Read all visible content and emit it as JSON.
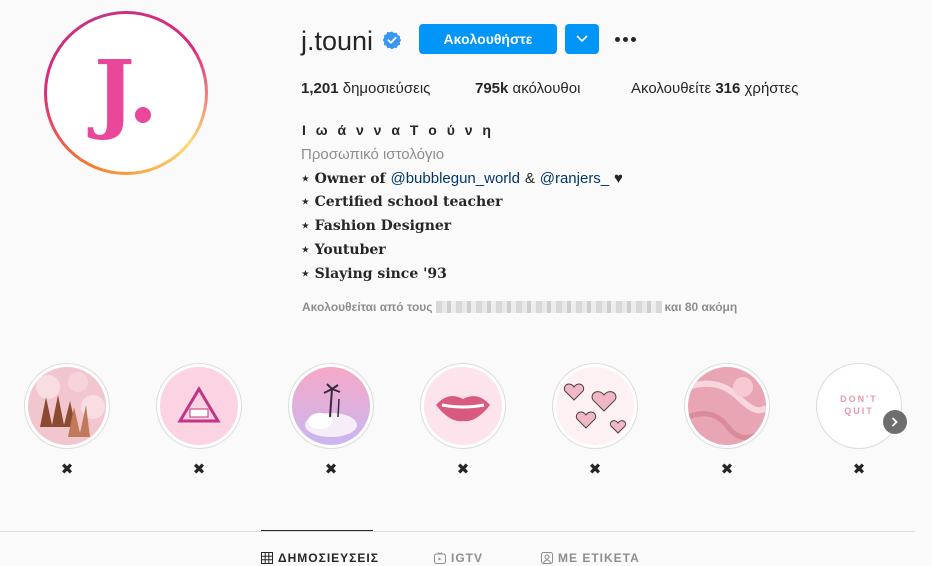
{
  "profile": {
    "username": "j.touni",
    "avatar_letter": "J.",
    "follow_label": "Ακολουθήστε",
    "stats": {
      "posts_count": "1,201",
      "posts_label": "δημοσιεύσεις",
      "followers_count": "795k",
      "followers_label": "ακόλουθοι",
      "following_prefix": "Ακολουθείτε",
      "following_count": "316",
      "following_suffix": "χρήστες"
    },
    "full_name": "Ι ω ά ν ν α Τ ο ύ ν η",
    "category": "Προσωπικό ιστολόγιο",
    "bio": {
      "line1_prefix": "⋆ Owner of",
      "line1_mention1": "@bubblegun_world",
      "line1_amp": "&",
      "line1_mention2": "@ranjers_",
      "line1_heart": "♥",
      "line2": "⋆ Certified school teacher",
      "line3": "⋆ Fashion Designer",
      "line4": "⋆ Youtuber",
      "line5": "⋆ Slaying since '93"
    },
    "followed_by_prefix": "Ακολουθείται από τους",
    "followed_by_suffix": "και 80 ακόμη"
  },
  "highlights": [
    {
      "label": "✖",
      "icon": "hands-photo"
    },
    {
      "label": "✖",
      "icon": "triangle-logo"
    },
    {
      "label": "✖",
      "icon": "palm-cloud"
    },
    {
      "label": "✖",
      "icon": "lips"
    },
    {
      "label": "✖",
      "icon": "hearts"
    },
    {
      "label": "✖",
      "icon": "pink-marble"
    },
    {
      "label": "✖",
      "icon": "dont-quit"
    }
  ],
  "highlight_dont_quit_text": "DON'T QUIT",
  "tabs": [
    {
      "label": "ΔΗΜΟΣΙΕΥΣΕΙΣ",
      "icon": "grid-icon",
      "active": true
    },
    {
      "label": "IGTV",
      "icon": "igtv-icon",
      "active": false
    },
    {
      "label": "ΜΕ ΕΤΙΚΕΤΑ",
      "icon": "tag-icon",
      "active": false
    }
  ],
  "colors": {
    "accent": "#0095f6",
    "brand_pink": "#e8479a",
    "verified": "#3897f0"
  }
}
